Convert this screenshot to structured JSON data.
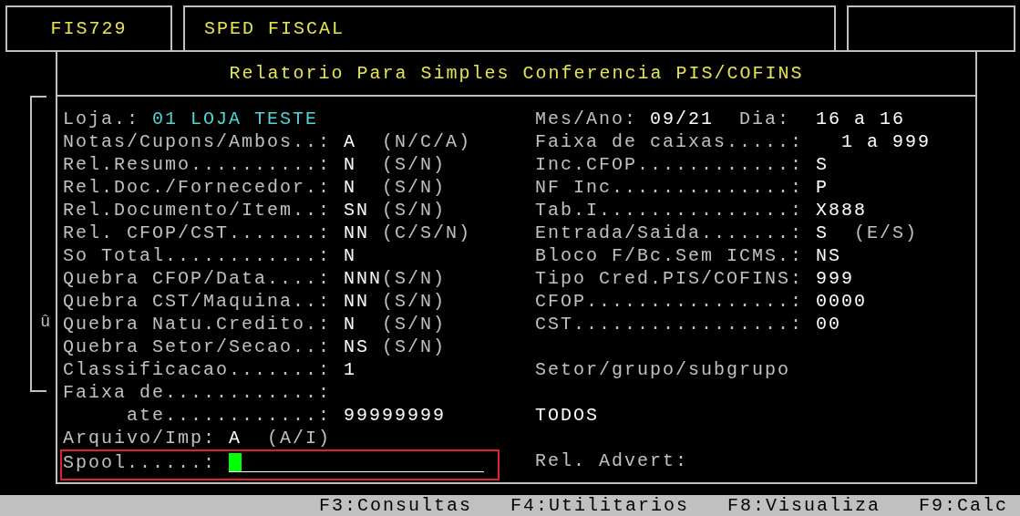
{
  "header": {
    "program": "FIS729",
    "module": "SPED FISCAL"
  },
  "dialog": {
    "title": "Relatorio Para Simples Conferencia PIS/COFINS",
    "scroll_marker": "û",
    "left_fields": [
      {
        "kind": "inline",
        "label": "Loja.:",
        "value": "01 LOJA TESTE",
        "color": "#4dd8d8"
      },
      {
        "kind": "field",
        "label": "Notas/Cupons/Ambos..:",
        "value": "A",
        "hint": "(N/C/A)"
      },
      {
        "kind": "field",
        "label": "Rel.Resumo..........:",
        "value": "N",
        "hint": "(S/N)"
      },
      {
        "kind": "field",
        "label": "Rel.Doc./Fornecedor.:",
        "value": "N",
        "hint": "(S/N)"
      },
      {
        "kind": "field",
        "label": "Rel.Documento/Item..:",
        "value": "SN",
        "hint": "(S/N)"
      },
      {
        "kind": "field",
        "label": "Rel. CFOP/CST.......:",
        "value": "NN",
        "hint": "(C/S/N)"
      },
      {
        "kind": "field",
        "label": "So Total............:",
        "value": "N"
      },
      {
        "kind": "field",
        "label": "Quebra CFOP/Data....:",
        "value": "NNN",
        "hint": "(S/N)"
      },
      {
        "kind": "field",
        "label": "Quebra CST/Maquina..:",
        "value": "NN",
        "hint": "(S/N)"
      },
      {
        "kind": "field",
        "label": "Quebra Natu.Credito.:",
        "value": "N",
        "hint": "(S/N)"
      },
      {
        "kind": "field",
        "label": "Quebra Setor/Secao..:",
        "value": "NS",
        "hint": "(S/N)"
      },
      {
        "kind": "field",
        "label": "Classificacao.......:",
        "value": "1"
      },
      {
        "kind": "field",
        "label": "Faixa de............:"
      },
      {
        "kind": "sub",
        "label": "ate............:",
        "value": "99999999"
      },
      {
        "kind": "inline",
        "label": "Arquivo/Imp:",
        "value": "A",
        "hint": "(A/I)"
      }
    ],
    "spool": {
      "label": "Spool......:",
      "focused": true,
      "highlighted": true
    },
    "right_fields": [
      {
        "kind": "date",
        "label": "Mes/Ano:",
        "value": "09/21",
        "day_label": "Dia:",
        "day_value": "16 a 16"
      },
      {
        "kind": "range",
        "label": "Faixa de caixas.....:",
        "value": "1 a 999"
      },
      {
        "kind": "field",
        "label": "Inc.CFOP............:",
        "value": "S"
      },
      {
        "kind": "field",
        "label": "NF Inc..............:",
        "value": "P"
      },
      {
        "kind": "field",
        "label": "Tab.I...............:",
        "value": "X888"
      },
      {
        "kind": "field",
        "label": "Entrada/Saida.......:",
        "value": "S",
        "hint": "(E/S)"
      },
      {
        "kind": "field",
        "label": "Bloco F/Bc.Sem ICMS.:",
        "value": "NS"
      },
      {
        "kind": "field",
        "label": "Tipo Cred.PIS/COFINS:",
        "value": "999"
      },
      {
        "kind": "field",
        "label": "CFOP................:",
        "value": "0000"
      },
      {
        "kind": "field",
        "label": "CST.................:",
        "value": "00"
      },
      {
        "kind": "note",
        "label": "Setor/grupo/subgrupo"
      },
      {
        "kind": "value",
        "label": "TODOS"
      },
      {
        "kind": "note",
        "label": "Rel. Advert:"
      }
    ]
  },
  "function_keys": [
    "F3:Consultas",
    "F4:Utilitarios",
    "F8:Visualiza",
    "F9:Calc"
  ]
}
